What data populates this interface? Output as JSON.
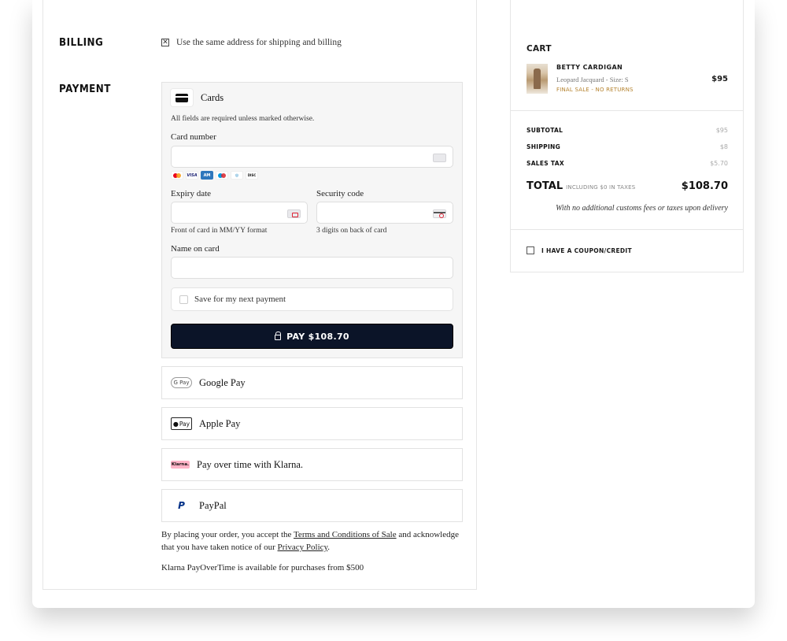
{
  "billing": {
    "label": "BILLING",
    "same_address_label": "Use the same address for shipping and billing",
    "same_address_checked": true
  },
  "payment": {
    "label": "PAYMENT",
    "cards": {
      "title": "Cards",
      "required_note": "All fields are required unless marked otherwise.",
      "card_number_label": "Card number",
      "card_number_value": "",
      "brands": [
        "mastercard",
        "visa",
        "amex",
        "maestro",
        "diners",
        "discover"
      ],
      "expiry_label": "Expiry date",
      "expiry_hint": "Front of card in MM/YY format",
      "security_label": "Security code",
      "security_hint": "3 digits on back of card",
      "name_label": "Name on card",
      "save_label": "Save for my next payment",
      "pay_button": "PAY $108.70"
    },
    "methods": [
      {
        "label": "Google Pay",
        "icon": "google-pay-icon",
        "badge": "G Pay"
      },
      {
        "label": "Apple Pay",
        "icon": "apple-pay-icon",
        "badge": "Pay"
      },
      {
        "label": "Pay over time with Klarna.",
        "icon": "klarna-icon",
        "badge": "Klarna."
      },
      {
        "label": "PayPal",
        "icon": "paypal-icon",
        "badge": "P"
      }
    ],
    "legal": {
      "pre": "By placing your order, you accept the ",
      "terms_link": "Terms and Conditions of Sale",
      "mid": " and acknowledge that you have taken notice of our ",
      "privacy_link": "Privacy Policy",
      "post": ".",
      "klarna_note": "Klarna PayOverTime is available for purchases from $500"
    }
  },
  "cart": {
    "title": "CART",
    "item": {
      "name": "BETTY CARDIGAN",
      "variant": "Leopard Jacquard - Size: S",
      "final_sale": "FINAL SALE - NO RETURNS",
      "price": "$95"
    },
    "subtotal_label": "SUBTOTAL",
    "subtotal_value": "$95",
    "shipping_label": "SHIPPING",
    "shipping_value": "$8",
    "tax_label": "SALES TAX",
    "tax_value": "$5.70",
    "total_label": "TOTAL",
    "total_sub": "INCLUDING $0 IN TAXES",
    "total_value": "$108.70",
    "customs_note": "With no additional customs fees or taxes upon delivery",
    "coupon_label": "I HAVE A COUPON/CREDIT"
  }
}
